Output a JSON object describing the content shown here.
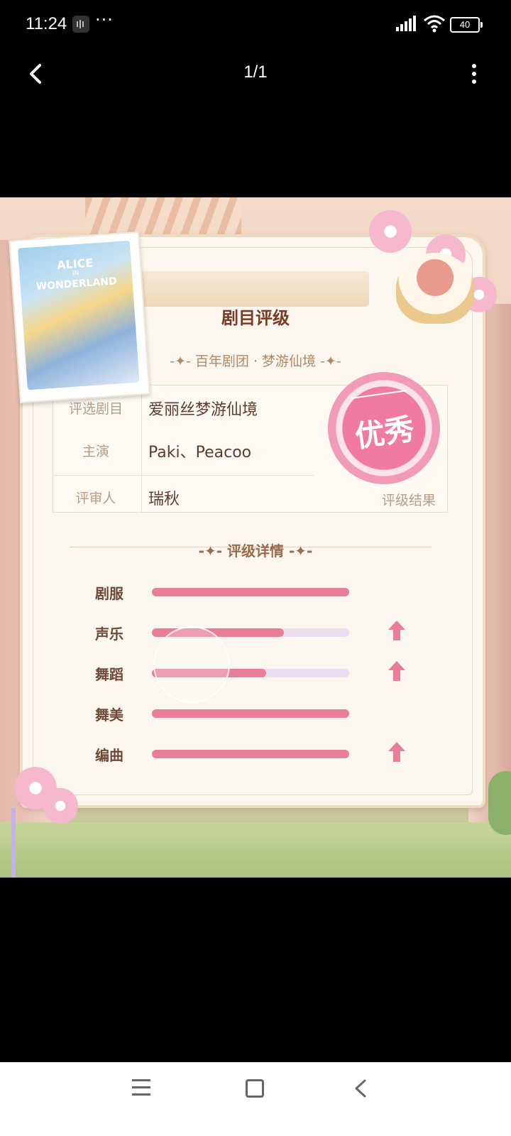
{
  "status_bar": {
    "time": "11:24",
    "more": "···",
    "battery": "40"
  },
  "app_bar": {
    "title": "1/1"
  },
  "card": {
    "title": "剧目评级",
    "subtitle": "-✦- 百年剧团 · 梦游仙境 -✦-",
    "info": [
      {
        "label": "评选剧目",
        "value": "爱丽丝梦游仙境"
      },
      {
        "label": "主演",
        "value": "Paki、Peacoo"
      },
      {
        "label": "评审人",
        "value": "瑞秋"
      }
    ],
    "result": {
      "grade": "优秀",
      "label": "评级结果"
    },
    "details_title": "-✦- 评级详情 -✦-",
    "details": [
      {
        "name": "剧服",
        "level": 1.0,
        "arrow": false
      },
      {
        "name": "声乐",
        "level": 0.67,
        "arrow": true
      },
      {
        "name": "舞蹈",
        "level": 0.58,
        "arrow": true
      },
      {
        "name": "舞美",
        "level": 1.0,
        "arrow": false
      },
      {
        "name": "编曲",
        "level": 1.0,
        "arrow": true
      }
    ]
  },
  "poster": {
    "line1": "ALICE",
    "line2": "IN",
    "line3": "WONDERLAND"
  },
  "colors": {
    "accent_pink": "#e97e9a",
    "track": "#e9def2",
    "title_brown": "#7b3a26"
  }
}
